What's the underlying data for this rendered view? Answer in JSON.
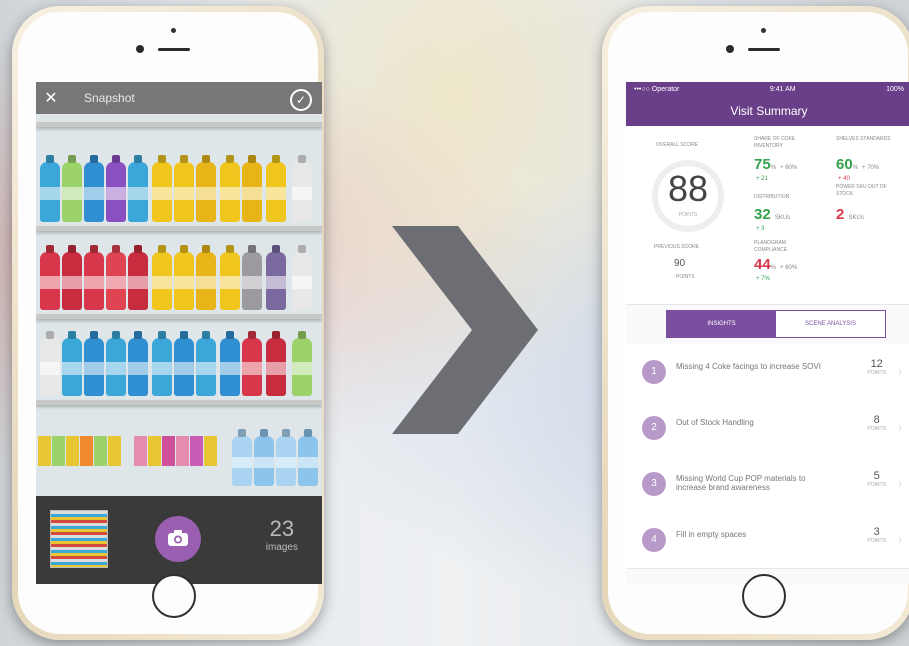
{
  "camera": {
    "close_label": "✕",
    "title": "Snapshot",
    "confirm_label": "✓",
    "image_count": "23",
    "image_count_label": "images"
  },
  "summary": {
    "status": {
      "carrier": "•••○○ Operator",
      "time": "9:41 AM",
      "battery": "100%"
    },
    "nav_title": "Visit Summary",
    "overall": {
      "label": "OVERALL SCORE",
      "value": "88",
      "unit": "POINTS"
    },
    "previous": {
      "label": "PREVIOUS SCORE",
      "value": "90",
      "unit": "POINTS"
    },
    "share_of_shelf": {
      "label": "SHARE OF COKE INVENTORY",
      "value": "75",
      "unit": "%",
      "target": "+ 60%",
      "delta": "+ 21"
    },
    "shelves_standards": {
      "label": "SHELVES STANDARDS",
      "value": "60",
      "unit": "%",
      "target": "+ 70%",
      "delta": "+ 40"
    },
    "distribution": {
      "label": "DISTRIBUTION",
      "value": "32",
      "unit": "SKUs",
      "delta": "+ 3"
    },
    "power_sku": {
      "label": "POWER SKU OUT OF STOCK",
      "value": "2",
      "unit": "SKUs"
    },
    "planogram": {
      "label": "PLANOGRAM COMPLIANCE",
      "value": "44",
      "unit": "%",
      "target": "+ 60%",
      "delta": "+ 7%"
    },
    "tabs": [
      "INSIGHTS",
      "SCENE ANALYSIS"
    ],
    "insights": [
      {
        "num": "1",
        "text": "Missing 4 Coke facings to increase SOVI",
        "value": "12",
        "unit": "POINTS"
      },
      {
        "num": "2",
        "text": "Out of Stock Handling",
        "value": "8",
        "unit": "POINTS"
      },
      {
        "num": "3",
        "text": "Missing World Cup POP materials to increase brand awareness",
        "value": "5",
        "unit": "POINTS"
      },
      {
        "num": "4",
        "text": "Fill in empty spaces",
        "value": "3",
        "unit": "POINTS"
      }
    ]
  },
  "colors": {
    "accent": "#6a3f8a",
    "positive": "#33a24a",
    "negative": "#d8364a"
  }
}
